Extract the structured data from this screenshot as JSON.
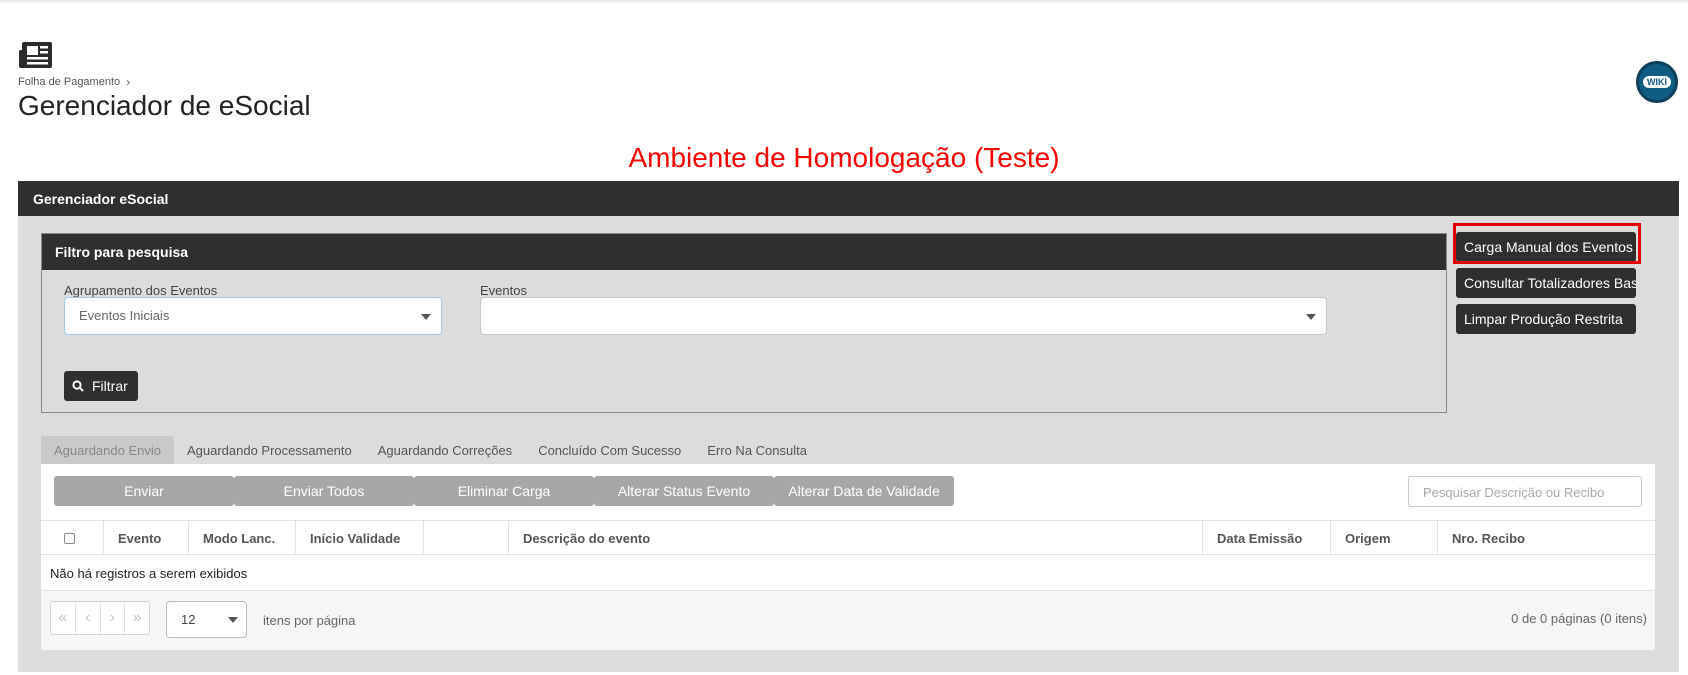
{
  "header": {
    "breadcrumb": [
      "Folha de Pagamento"
    ],
    "breadcrumb_separator": "›",
    "title": "Gerenciador de eSocial",
    "wiki_label": "WIKI",
    "page_icon": "newspaper-icon"
  },
  "environment_banner": "Ambiente de Homologação (Teste)",
  "panel": {
    "title": "Gerenciador eSocial",
    "filter": {
      "title": "Filtro para pesquisa",
      "grouping_label": "Agrupamento dos Eventos",
      "grouping_value": "Eventos Iniciais",
      "events_label": "Eventos",
      "events_value": "",
      "filter_button": "Filtrar",
      "filter_icon": "search-icon"
    },
    "side_buttons": [
      "Carga Manual dos Eventos",
      "Consultar Totalizadores Base",
      "Limpar Produção Restrita"
    ],
    "tabs": [
      "Aguardando Envio",
      "Aguardando Processamento",
      "Aguardando Correções",
      "Concluído Com Sucesso",
      "Erro Na Consulta"
    ],
    "active_tab": "Aguardando Envio",
    "actions": [
      "Enviar",
      "Enviar Todos",
      "Eliminar Carga",
      "Alterar Status Evento",
      "Alterar Data de Validade"
    ],
    "search_placeholder": "Pesquisar Descrição ou Recibo",
    "columns": [
      "",
      "Evento",
      "Modo Lanc.",
      "Início Validade",
      "",
      "Descrição do evento",
      "Data Emissão",
      "Origem",
      "Nro. Recibo"
    ],
    "empty_message": "Não há registros a serem exibidos",
    "pager": {
      "nav": [
        "«",
        "‹",
        "›",
        "»"
      ],
      "page_size": "12",
      "page_size_label": "itens por página",
      "info": "0 de 0 páginas (0 itens)"
    }
  },
  "colors": {
    "banner": "#ff0000",
    "dark_header": "#2f2f2f",
    "panel_bg": "#dcdcdc",
    "disabled_button": "#a7a7a7",
    "highlight": "#e00000",
    "wiki": "#0f5c82"
  }
}
